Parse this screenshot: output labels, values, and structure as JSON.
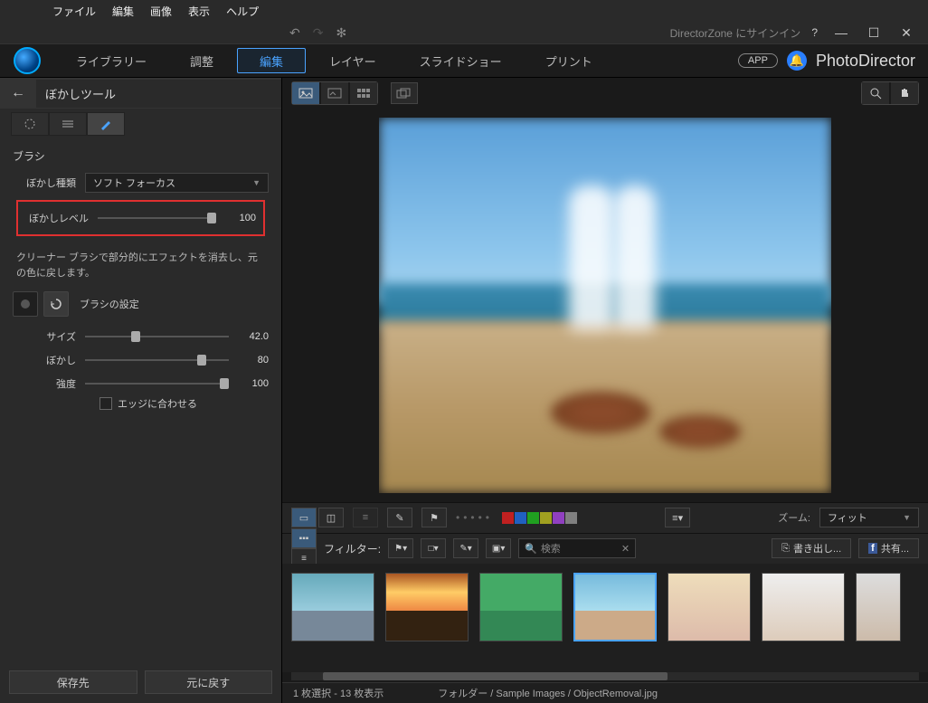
{
  "menubar": {
    "file": "ファイル",
    "edit": "編集",
    "image": "画像",
    "view": "表示",
    "help": "ヘルプ"
  },
  "topright": {
    "dzone": "DirectorZone にサインイン",
    "help": "?",
    "min": "—",
    "max": "☐",
    "close": "✕"
  },
  "maintabs": {
    "library": "ライブラリー",
    "adjust": "調整",
    "editing": "編集",
    "layer": "レイヤー",
    "slideshow": "スライドショー",
    "print": "プリント"
  },
  "app": {
    "badge": "APP",
    "brand": "PhotoDirector"
  },
  "sidebar": {
    "title": "ぼかしツール",
    "section": "ブラシ",
    "blur_type_label": "ぼかし種類",
    "blur_type_value": "ソフト フォーカス",
    "blur_level_label": "ぼかしレベル",
    "blur_level_value": "100",
    "cleaner_desc": "クリーナー ブラシで部分的にエフェクトを消去し、元の色に戻します。",
    "brush_settings": "ブラシの設定",
    "size_label": "サイズ",
    "size_value": "42.0",
    "blur_label": "ぼかし",
    "blur_value": "80",
    "strength_label": "強度",
    "strength_value": "100",
    "fit_edges": "エッジに合わせる",
    "save_btn": "保存先",
    "reset_btn": "元に戻す"
  },
  "midbar": {
    "zoom_label": "ズーム:",
    "zoom_value": "フィット"
  },
  "filterbar": {
    "filter_label": "フィルター:",
    "search_placeholder": "検索",
    "export_btn": "書き出し...",
    "share_btn": "共有..."
  },
  "status": {
    "selection": "1 枚選択 - 13 枚表示",
    "path": "フォルダー / Sample Images / ObjectRemoval.jpg"
  },
  "swatches": [
    "#c02020",
    "#2060c0",
    "#20a020",
    "#a0a020",
    "#9040c0",
    "#808080"
  ]
}
